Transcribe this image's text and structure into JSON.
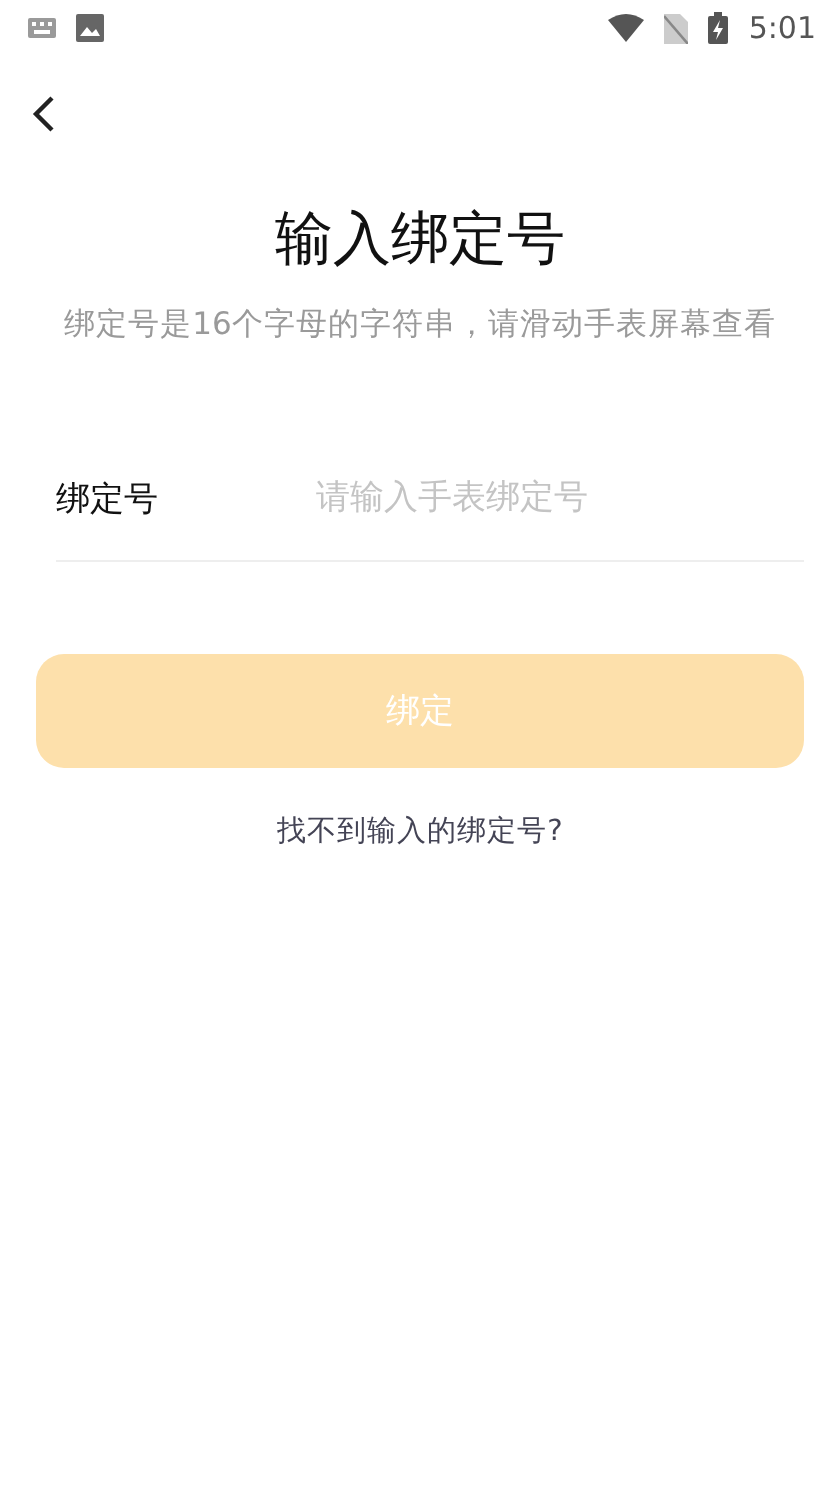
{
  "status_bar": {
    "time": "5:01"
  },
  "title": "输入绑定号",
  "subtitle": "绑定号是16个字母的字符串，请滑动手表屏幕查看",
  "field": {
    "label": "绑定号",
    "placeholder": "请输入手表绑定号"
  },
  "bind_button": {
    "label": "绑定",
    "disabled": true
  },
  "help_link": "找不到输入的绑定号?"
}
